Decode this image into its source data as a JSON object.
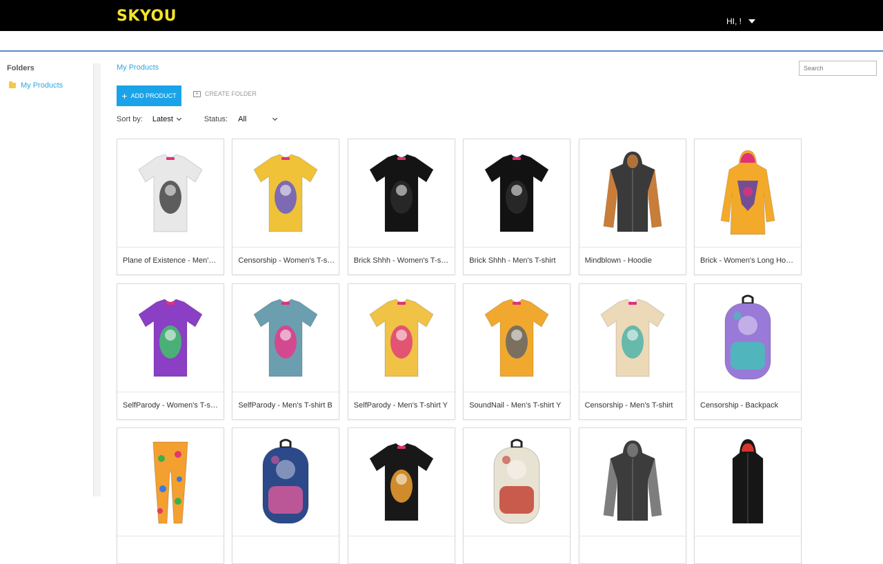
{
  "app": {
    "logo": "SKYOU",
    "user_greeting": "HI, !"
  },
  "sidebar": {
    "title": "Folders",
    "items": [
      {
        "label": "My Products"
      }
    ]
  },
  "breadcrumb": "My Products",
  "search": {
    "placeholder": "Search"
  },
  "toolbar": {
    "add_label": "ADD PRODUCT",
    "create_folder_label": "CREATE FOLDER"
  },
  "filters": {
    "sort_label": "Sort by:",
    "sort_value": "Latest",
    "status_label": "Status:",
    "status_value": "All"
  },
  "products": [
    {
      "name": "Plane of Existence - Men's T-shirt",
      "type": "tee",
      "color": "#e8e8e8",
      "accent": "#444444"
    },
    {
      "name": "Censorship - Women's T-shirt",
      "type": "tee",
      "color": "#f0c238",
      "accent": "#6a5bc8"
    },
    {
      "name": "Brick Shhh - Women's T-shirt",
      "type": "tee",
      "color": "#141414",
      "accent": "#2a2a2a"
    },
    {
      "name": "Brick Shhh - Men's T-shirt",
      "type": "tee",
      "color": "#121212",
      "accent": "#2c2c2c"
    },
    {
      "name": "Mindblown - Hoodie",
      "type": "hoodie",
      "color": "#3a3a3a",
      "accent": "#e28a3a"
    },
    {
      "name": "Brick - Women's Long Hoodie",
      "type": "longhoodie",
      "color": "#f3a92a",
      "accent": "#e0317a"
    },
    {
      "name": "SelfParody - Women's T-shirt",
      "type": "tee",
      "color": "#8a3fc4",
      "accent": "#3ec46a"
    },
    {
      "name": "SelfParody - Men's T-shirt B",
      "type": "tee",
      "color": "#6b9faf",
      "accent": "#e53a8a"
    },
    {
      "name": "SelfParody - Men's T-shirt Y",
      "type": "tee",
      "color": "#f0c245",
      "accent": "#e0407a"
    },
    {
      "name": "SoundNail - Men's T-shirt Y",
      "type": "tee",
      "color": "#f0a92e",
      "accent": "#666666"
    },
    {
      "name": "Censorship - Men's T-shirt",
      "type": "tee",
      "color": "#ecd9b8",
      "accent": "#4fb3a8"
    },
    {
      "name": "Censorship - Backpack",
      "type": "backpack",
      "color": "#9a7ad8",
      "accent": "#3ec4b6"
    },
    {
      "name": "",
      "type": "leggings",
      "color": "#f4a030",
      "accent": "#3bb04a"
    },
    {
      "name": "",
      "type": "backpack",
      "color": "#2c4a8a",
      "accent": "#e05a9a"
    },
    {
      "name": "",
      "type": "tee",
      "color": "#181818",
      "accent": "#f0a030"
    },
    {
      "name": "",
      "type": "backpack",
      "color": "#e8e2d2",
      "accent": "#c0392b"
    },
    {
      "name": "",
      "type": "hoodie",
      "color": "#3c3c3c",
      "accent": "#8a8a8a"
    },
    {
      "name": "",
      "type": "vest",
      "color": "#161616",
      "accent": "#d8352a"
    }
  ]
}
